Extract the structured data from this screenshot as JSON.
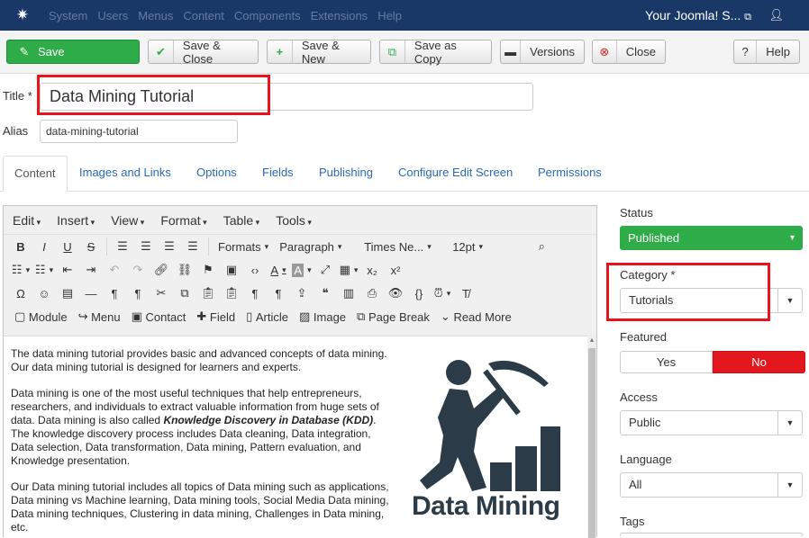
{
  "navbar": {
    "menu": [
      "System",
      "Users",
      "Menus",
      "Content",
      "Components",
      "Extensions",
      "Help"
    ],
    "site_name": "Your Joomla! S...",
    "site_icon": "external-link-icon",
    "user_icon": "user-icon"
  },
  "toolbar": {
    "save": "Save",
    "save_close": "Save & Close",
    "save_new": "Save & New",
    "save_copy": "Save as Copy",
    "versions": "Versions",
    "close": "Close",
    "help": "Help"
  },
  "form": {
    "title_label": "Title *",
    "title_value": "Data Mining Tutorial",
    "alias_label": "Alias",
    "alias_value": "data-mining-tutorial"
  },
  "tabs": [
    "Content",
    "Images and Links",
    "Options",
    "Fields",
    "Publishing",
    "Configure Edit Screen",
    "Permissions"
  ],
  "editor": {
    "menubar": [
      "Edit",
      "Insert",
      "View",
      "Format",
      "Table",
      "Tools"
    ],
    "formats": "Formats",
    "paragraph": "Paragraph",
    "font": "Times Ne...",
    "size": "12pt",
    "buttons": {
      "module": "Module",
      "menu": "Menu",
      "contact": "Contact",
      "field": "Field",
      "article": "Article",
      "image": "Image",
      "page_break": "Page Break",
      "read_more": "Read More"
    },
    "para1": "The data mining tutorial provides basic and advanced concepts of data mining. Our data mining tutorial is designed for learners and experts.",
    "para2_a": "Data mining is one of the most useful techniques that help entrepreneurs, researchers, and individuals to extract valuable information from huge sets of data. Data mining is also called ",
    "para2_em": "Knowledge Discovery in Database (KDD)",
    "para2_b": ". The knowledge discovery process includes Data cleaning, Data integration, Data selection, Data transformation, Data mining, Pattern evaluation, and Knowledge presentation.",
    "para3": "Our Data mining tutorial includes all topics of Data mining such as applications, Data mining vs Machine learning, Data mining tools, Social Media Data mining, Data mining techniques, Clustering in data mining, Challenges in Data mining, etc.",
    "image_caption": "Data Mining"
  },
  "sidebar": {
    "status_label": "Status",
    "status_value": "Published",
    "category_label": "Category *",
    "category_value": "Tutorials",
    "featured_label": "Featured",
    "featured_yes": "Yes",
    "featured_no": "No",
    "access_label": "Access",
    "access_value": "Public",
    "language_label": "Language",
    "language_value": "All",
    "tags_label": "Tags"
  },
  "colors": {
    "navbar": "#1a3867",
    "save_green": "#2eac48",
    "featured_no_red": "#e3171d",
    "highlight_red": "#e8141c"
  }
}
